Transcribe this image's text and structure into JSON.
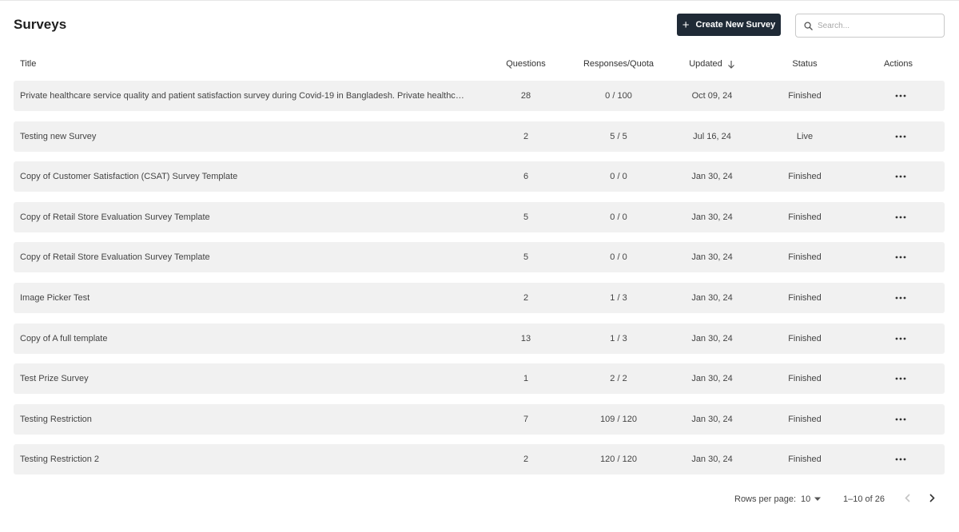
{
  "header": {
    "title": "Surveys",
    "create_label": "Create New Survey",
    "search_placeholder": "Search..."
  },
  "columns": {
    "title": "Title",
    "questions": "Questions",
    "responses": "Responses/Quota",
    "updated": "Updated",
    "status": "Status",
    "actions": "Actions"
  },
  "rows": [
    {
      "title": "Private healthcare service quality and patient satisfaction survey during Covid-19 in Bangladesh. Private healthcare ser...",
      "questions": "28",
      "responses": "0 / 100",
      "updated": "Oct 09, 24",
      "status": "Finished"
    },
    {
      "title": "Testing new Survey",
      "questions": "2",
      "responses": "5 / 5",
      "updated": "Jul 16, 24",
      "status": "Live"
    },
    {
      "title": "Copy of Customer Satisfaction (CSAT) Survey Template",
      "questions": "6",
      "responses": "0 / 0",
      "updated": "Jan 30, 24",
      "status": "Finished"
    },
    {
      "title": "Copy of Retail Store Evaluation Survey Template",
      "questions": "5",
      "responses": "0 / 0",
      "updated": "Jan 30, 24",
      "status": "Finished"
    },
    {
      "title": "Copy of Retail Store Evaluation Survey Template",
      "questions": "5",
      "responses": "0 / 0",
      "updated": "Jan 30, 24",
      "status": "Finished"
    },
    {
      "title": "Image Picker Test",
      "questions": "2",
      "responses": "1 / 3",
      "updated": "Jan 30, 24",
      "status": "Finished"
    },
    {
      "title": "Copy of A full template",
      "questions": "13",
      "responses": "1 / 3",
      "updated": "Jan 30, 24",
      "status": "Finished"
    },
    {
      "title": "Test Prize Survey",
      "questions": "1",
      "responses": "2 / 2",
      "updated": "Jan 30, 24",
      "status": "Finished"
    },
    {
      "title": "Testing Restriction",
      "questions": "7",
      "responses": "109 / 120",
      "updated": "Jan 30, 24",
      "status": "Finished"
    },
    {
      "title": "Testing Restriction 2",
      "questions": "2",
      "responses": "120 / 120",
      "updated": "Jan 30, 24",
      "status": "Finished"
    }
  ],
  "pagination": {
    "rows_per_page_label": "Rows per page:",
    "rows_per_page_value": "10",
    "range": "1–10 of 26"
  },
  "icons": {
    "create": "plus-icon",
    "search": "search-icon",
    "sort": "arrow-down-icon",
    "row_action": "more-horizontal-icon",
    "dropdown": "caret-down-icon",
    "prev": "chevron-left-icon",
    "next": "chevron-right-icon"
  },
  "colors": {
    "primary_button": "#1f2a36",
    "row_background": "#f1f1f1"
  }
}
